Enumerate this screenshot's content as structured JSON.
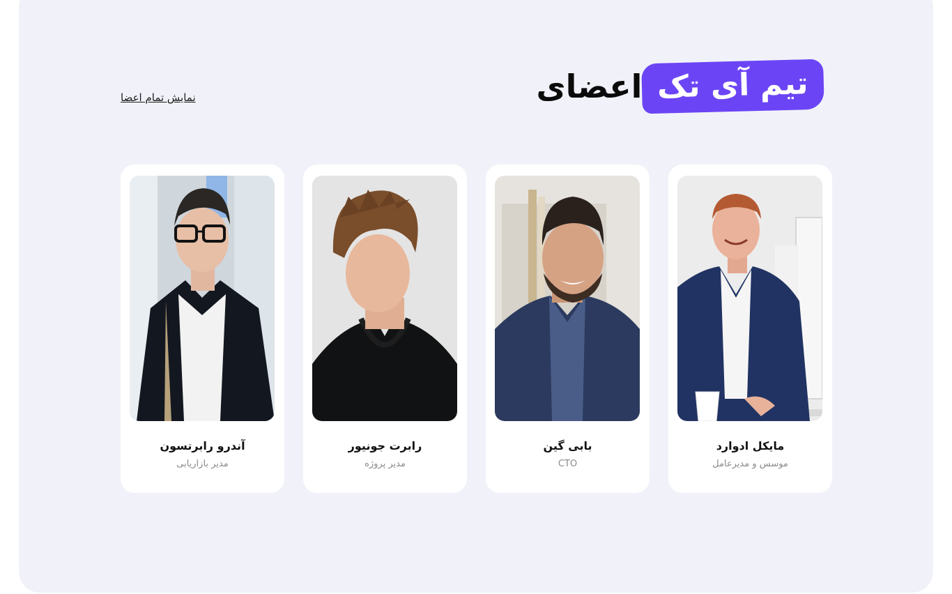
{
  "header": {
    "title_word": "اعضای",
    "title_highlight": "تیم آی تک",
    "accent_color": "#6b45f5"
  },
  "actions": {
    "show_all_label": "نمایش تمام اعضا"
  },
  "members": [
    {
      "name": "مایکل ادوارد",
      "role": "موسس و مدیرعامل",
      "photo": "man-in-navy-suit-photo"
    },
    {
      "name": "بابی گین",
      "role": "CTO",
      "photo": "smiling-bearded-man-photo"
    },
    {
      "name": "رابرت جونیور",
      "role": "مدیر پروژه",
      "photo": "young-man-black-hoodie-photo"
    },
    {
      "name": "آندرو رابرتسون",
      "role": "مدیر بازاریابی",
      "photo": "man-with-glasses-photo"
    }
  ]
}
